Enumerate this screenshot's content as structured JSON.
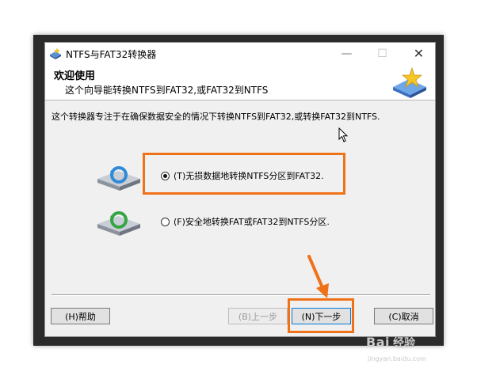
{
  "window": {
    "title": "NTFS与FAT32转换器",
    "minimize_symbol": "—",
    "maximize_symbol": "☐",
    "close_symbol": "✕"
  },
  "header": {
    "title": "欢迎使用",
    "subtitle": "这个向导能转换NTFS到FAT32,或FAT32到NTFS"
  },
  "body": {
    "description": "这个转换器专注于在确保数据安全的情况下转换NTFS到FAT32,或转换FAT32到NTFS."
  },
  "options": [
    {
      "label": "(T)无损数据地转换NTFS分区到FAT32.",
      "selected": true,
      "icon": "drive-blue-arrow-icon"
    },
    {
      "label": "(F)安全地转换FAT或FAT32到NTFS分区.",
      "selected": false,
      "icon": "drive-green-arrow-icon"
    }
  ],
  "buttons": {
    "help": "(H)帮助",
    "back": "(B)上一步",
    "next": "(N)下一步",
    "cancel": "(C)取消"
  },
  "annotations": {
    "highlight_color": "#f07218"
  },
  "watermark": {
    "brand": "Bai",
    "brand2": "经验",
    "url": "jingyan.baidu.com"
  }
}
